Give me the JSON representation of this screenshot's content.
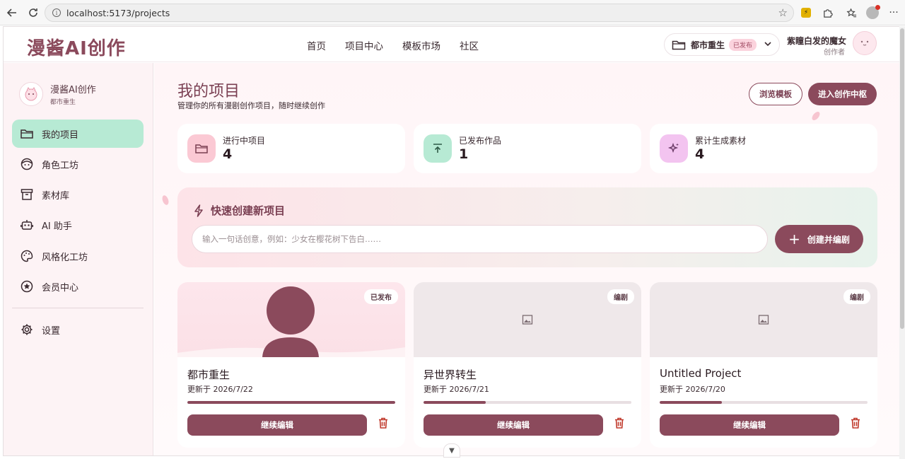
{
  "browser": {
    "url": "localhost:5173/projects"
  },
  "header": {
    "brand": "漫酱AI创作",
    "nav": [
      "首页",
      "项目中心",
      "模板市场",
      "社区"
    ],
    "project_selector": {
      "name": "都市重生",
      "status": "已发布"
    },
    "user": {
      "name": "紫瞳白发的魔女",
      "role": "创作者"
    }
  },
  "sidebar": {
    "brand_title": "漫酱AI创作",
    "brand_sub": "都市重生",
    "items": [
      {
        "label": "我的项目",
        "icon": "folder-icon"
      },
      {
        "label": "角色工坊",
        "icon": "face-icon"
      },
      {
        "label": "素材库",
        "icon": "archive-icon"
      },
      {
        "label": "AI 助手",
        "icon": "robot-icon"
      },
      {
        "label": "风格化工坊",
        "icon": "palette-icon"
      },
      {
        "label": "会员中心",
        "icon": "star-icon"
      }
    ],
    "settings_label": "设置"
  },
  "main": {
    "title": "我的项目",
    "subtitle": "管理你的所有漫剧创作项目，随时继续创作",
    "browse_templates": "浏览模板",
    "enter_studio": "进入创作中枢",
    "stats": [
      {
        "label": "进行中项目",
        "value": "4",
        "color": "#fbc9d4"
      },
      {
        "label": "已发布作品",
        "value": "1",
        "color": "#b7ead4"
      },
      {
        "label": "累计生成素材",
        "value": "4",
        "color": "#f3c4f0"
      }
    ],
    "quick": {
      "title": "快速创建新项目",
      "placeholder": "输入一句话创意，例如：少女在樱花树下告白……",
      "button": "创建并编剧"
    },
    "projects": [
      {
        "name": "都市重生",
        "date": "更新于 2026/7/22",
        "badge": "已发布",
        "progress": 1.0,
        "action": "继续编辑"
      },
      {
        "name": "异世界转生",
        "date": "更新于 2026/7/21",
        "badge": "编剧",
        "progress": 0.3,
        "action": "继续编辑"
      },
      {
        "name": "Untitled Project",
        "date": "更新于 2026/7/20",
        "badge": "编剧",
        "progress": 0.3,
        "action": "继续编辑"
      }
    ]
  },
  "colors": {
    "accent": "#8b4a5c",
    "active_nav": "#b7ead4",
    "sidebar_bg": "#fdf3f5"
  }
}
